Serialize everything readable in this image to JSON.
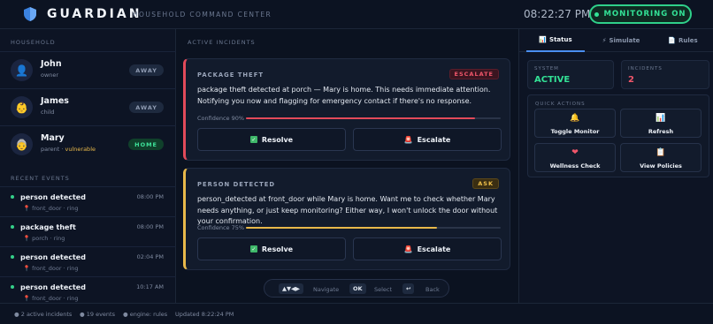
{
  "header": {
    "brand": "GUARDIAN",
    "subtitle": "HOUSEHOLD COMMAND CENTER",
    "clock": "08:22:27 PM",
    "monitor_label": "MONITORING ON"
  },
  "household": {
    "label": "HOUSEHOLD",
    "members": [
      {
        "name": "John",
        "role": "owner",
        "extra": "",
        "status": "AWAY",
        "avatar": "👤"
      },
      {
        "name": "James",
        "role": "child",
        "extra": "",
        "status": "AWAY",
        "avatar": "👶"
      },
      {
        "name": "Mary",
        "role": "parent · ",
        "extra": "vulnerable",
        "status": "HOME",
        "avatar": "👵"
      }
    ]
  },
  "recent_events": {
    "label": "RECENT EVENTS",
    "items": [
      {
        "title": "person detected",
        "time": "08:00 PM",
        "location": "front_door · ring"
      },
      {
        "title": "package theft",
        "time": "08:00 PM",
        "location": "porch · ring"
      },
      {
        "title": "person detected",
        "time": "02:04 PM",
        "location": "front_door · ring"
      },
      {
        "title": "person detected",
        "time": "10:17 AM",
        "location": "front_door · ring"
      }
    ]
  },
  "incidents": {
    "label": "ACTIVE INCIDENTS",
    "cards": [
      {
        "title": "PACKAGE THEFT",
        "tag": "ESCALATE",
        "message": "package theft detected at porch — Mary is home. This needs immediate attention. Notifying you now and flagging for emergency contact if there's no response.",
        "confidence_label": "Confidence 90%",
        "confidence": 0.9,
        "color": "#e24a5a",
        "resolve": "Resolve",
        "escalate": "Escalate"
      },
      {
        "title": "PERSON DETECTED",
        "tag": "ASK",
        "message": "person_detected at front_door while Mary is home. Want me to check whether Mary needs anything, or just keep monitoring? Either way, I won't unlock the door without your confirmation.",
        "confidence_label": "Confidence 75%",
        "confidence": 0.75,
        "color": "#e8b84a",
        "resolve": "Resolve",
        "escalate": "Escalate"
      }
    ]
  },
  "nav_hint": {
    "arrows": "▲▼◀▶",
    "navigate": "Navigate",
    "ok": "OK",
    "select": "Select",
    "back_key": "↩",
    "back": "Back"
  },
  "tabs": [
    {
      "label": "Status",
      "icon": "📊"
    },
    {
      "label": "Simulate",
      "icon": "⚡"
    },
    {
      "label": "Rules",
      "icon": "📄"
    }
  ],
  "status": {
    "system_label": "SYSTEM",
    "system_value": "ACTIVE",
    "incidents_label": "INCIDENTS",
    "incidents_value": "2"
  },
  "quick_actions": {
    "label": "QUICK ACTIONS",
    "items": [
      {
        "label": "Toggle Monitor",
        "icon": "🔔"
      },
      {
        "label": "Refresh",
        "icon": "📊"
      },
      {
        "label": "Wellness Check",
        "icon": "❤"
      },
      {
        "label": "View Policies",
        "icon": "📋"
      }
    ]
  },
  "footer": {
    "incidents": "● 2 active incidents",
    "events": "● 19 events",
    "engine": "● engine: rules",
    "updated": "Updated 8:22:24 PM"
  },
  "colors": {
    "accent_green": "#33e296",
    "danger": "#e24a5a",
    "warning": "#e8b84a"
  }
}
